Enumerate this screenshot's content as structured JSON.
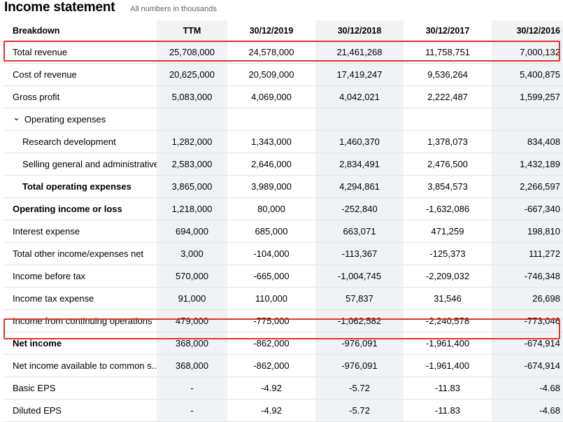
{
  "header": {
    "title": "Income statement",
    "subtitle": "All numbers in thousands"
  },
  "columns": [
    "Breakdown",
    "TTM",
    "30/12/2019",
    "30/12/2018",
    "30/12/2017",
    "30/12/2016"
  ],
  "rows": [
    {
      "label": "Total revenue",
      "values": [
        "25,708,000",
        "24,578,000",
        "21,461,268",
        "11,758,751",
        "7,000,132"
      ]
    },
    {
      "label": "Cost of revenue",
      "values": [
        "20,625,000",
        "20,509,000",
        "17,419,247",
        "9,536,264",
        "5,400,875"
      ]
    },
    {
      "label": "Gross profit",
      "values": [
        "5,083,000",
        "4,069,000",
        "4,042,021",
        "2,222,487",
        "1,599,257"
      ]
    },
    {
      "label": "Operating expenses",
      "values": [
        "",
        "",
        "",
        "",
        ""
      ]
    },
    {
      "label": "Research development",
      "values": [
        "1,282,000",
        "1,343,000",
        "1,460,370",
        "1,378,073",
        "834,408"
      ]
    },
    {
      "label": "Selling general and administrative",
      "values": [
        "2,583,000",
        "2,646,000",
        "2,834,491",
        "2,476,500",
        "1,432,189"
      ]
    },
    {
      "label": "Total operating expenses",
      "values": [
        "3,865,000",
        "3,989,000",
        "4,294,861",
        "3,854,573",
        "2,266,597"
      ]
    },
    {
      "label": "Operating income or loss",
      "values": [
        "1,218,000",
        "80,000",
        "-252,840",
        "-1,632,086",
        "-667,340"
      ]
    },
    {
      "label": "Interest expense",
      "values": [
        "694,000",
        "685,000",
        "663,071",
        "471,259",
        "198,810"
      ]
    },
    {
      "label": "Total other income/expenses net",
      "values": [
        "3,000",
        "-104,000",
        "-113,367",
        "-125,373",
        "111,272"
      ]
    },
    {
      "label": "Income before tax",
      "values": [
        "570,000",
        "-665,000",
        "-1,004,745",
        "-2,209,032",
        "-746,348"
      ]
    },
    {
      "label": "Income tax expense",
      "values": [
        "91,000",
        "110,000",
        "57,837",
        "31,546",
        "26,698"
      ]
    },
    {
      "label": "Income from continuing operations",
      "values": [
        "479,000",
        "-775,000",
        "-1,062,582",
        "-2,240,578",
        "-773,046"
      ]
    },
    {
      "label": "Net income",
      "values": [
        "368,000",
        "-862,000",
        "-976,091",
        "-1,961,400",
        "-674,914"
      ]
    },
    {
      "label": "Net income available to common s...",
      "values": [
        "368,000",
        "-862,000",
        "-976,091",
        "-1,961,400",
        "-674,914"
      ]
    },
    {
      "label": "Basic EPS",
      "values": [
        "-",
        "-4.92",
        "-5.72",
        "-11.83",
        "-4.68"
      ]
    },
    {
      "label": "Diluted EPS",
      "values": [
        "-",
        "-4.92",
        "-5.72",
        "-11.83",
        "-4.68"
      ]
    }
  ],
  "icons": {
    "expand": "chevron-down-icon"
  },
  "colors": {
    "highlight": "#e0342a",
    "shade": "#f0f3f5",
    "border": "#e3e4e6"
  }
}
